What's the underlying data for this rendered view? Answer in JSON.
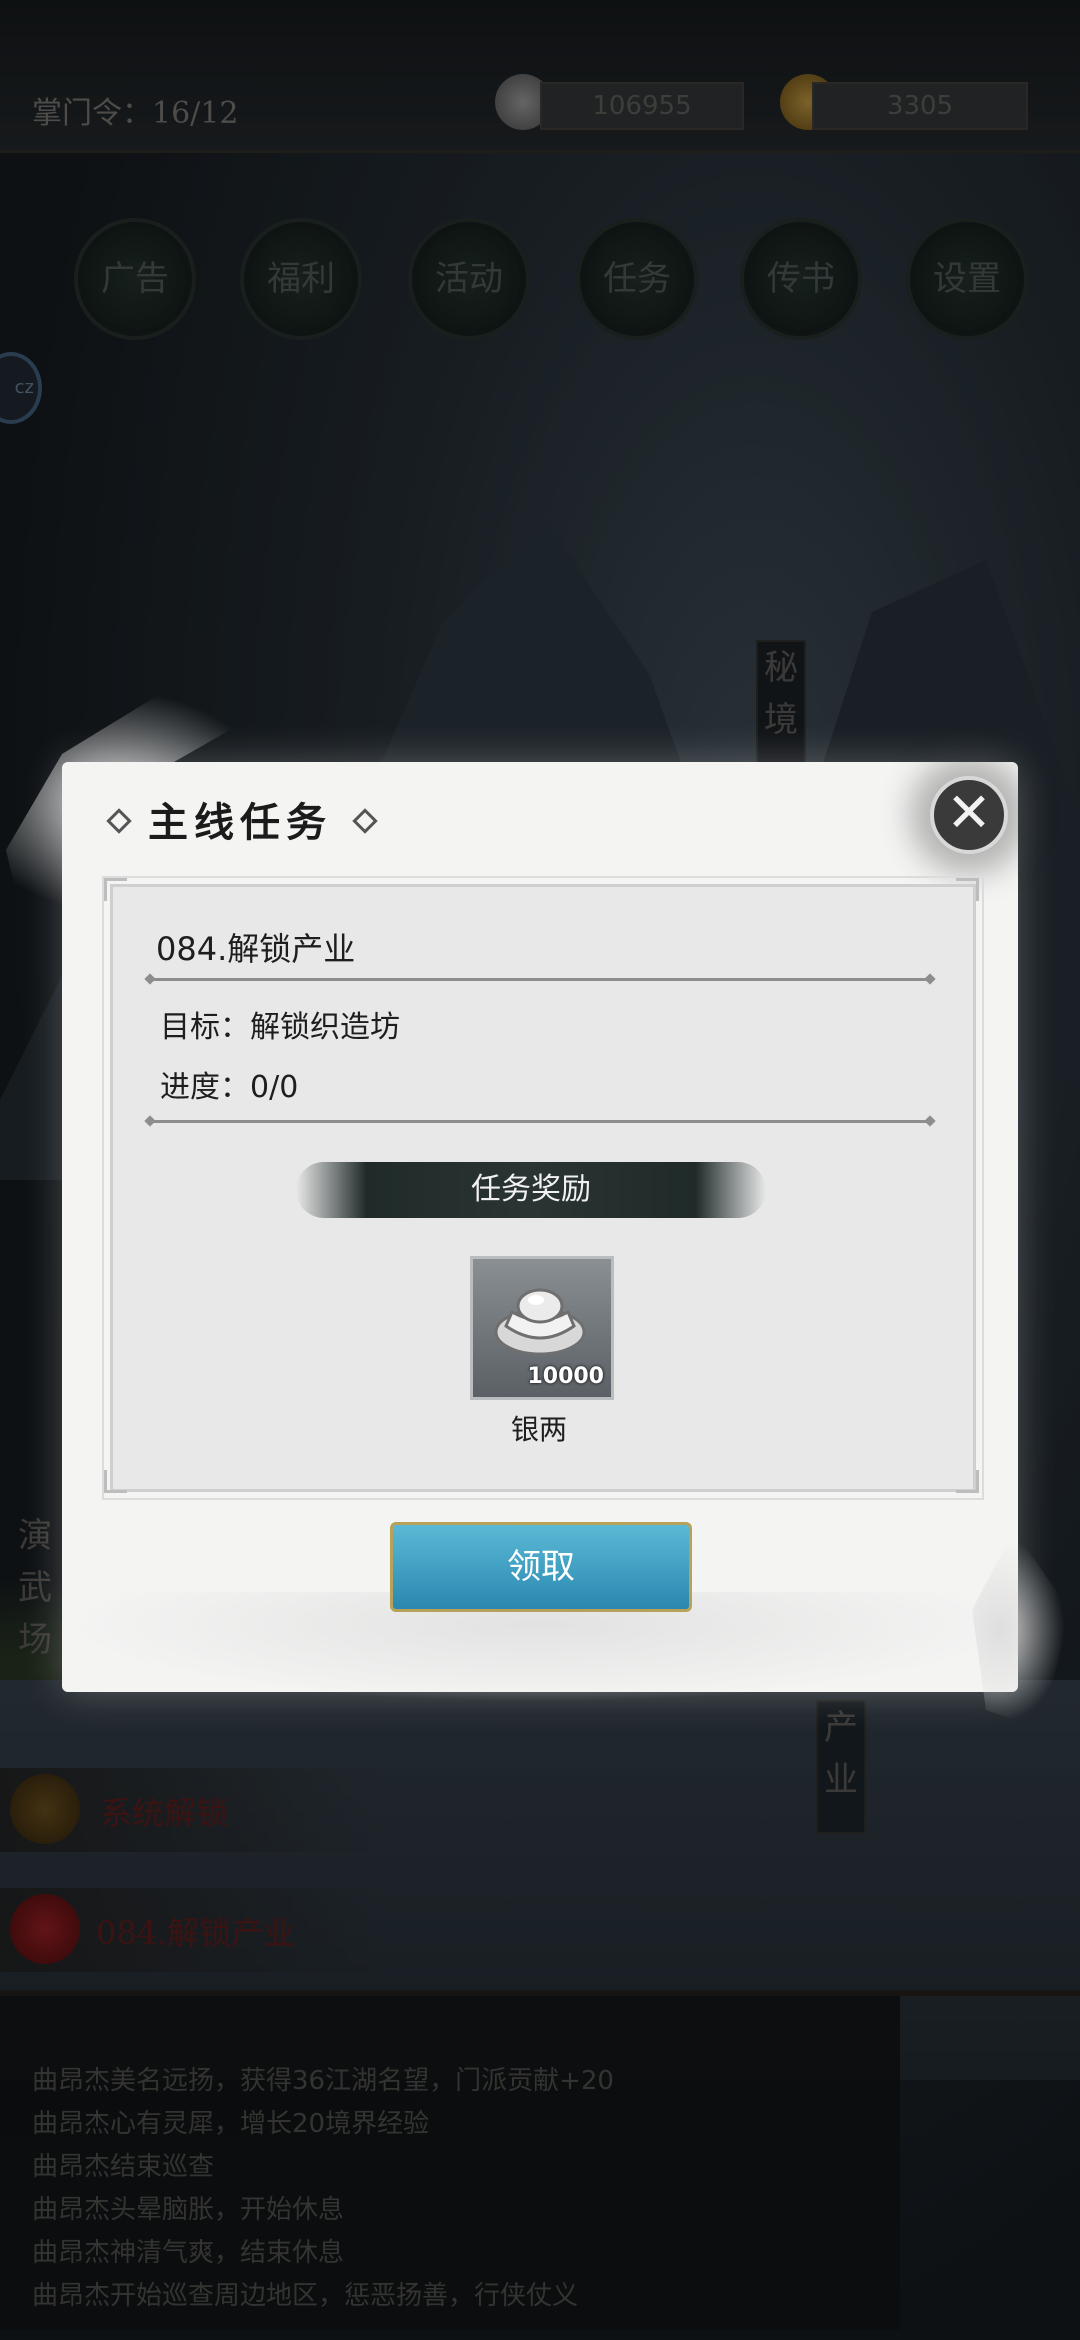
{
  "topbar": {
    "token_label": "掌门令：16/12",
    "silver_amount": "106955",
    "gold_amount": "3305"
  },
  "menu": {
    "items": [
      "广告",
      "福利",
      "活动",
      "任务",
      "传书",
      "设置"
    ]
  },
  "side_badge": "cz",
  "map_tags": {
    "secret_realm": "秘境",
    "arena": "演武场",
    "industry": "产业"
  },
  "notices": {
    "system_unlock": "系统解锁",
    "current_quest": "084.解锁产业"
  },
  "log": {
    "lines": [
      "曲昂杰美名远扬，获得36江湖名望，门派贡献+20",
      "曲昂杰心有灵犀，增长20境界经验",
      "曲昂杰结束巡查",
      "曲昂杰头晕脑胀，开始休息",
      "曲昂杰神清气爽，结束休息",
      "曲昂杰开始巡查周边地区，惩恶扬善，行侠仗义"
    ]
  },
  "dialog": {
    "title": "主线任务",
    "close_icon": "close-icon",
    "quest_name": "084.解锁产业",
    "goal": "目标：解锁织造坊",
    "progress": "进度：0/0",
    "reward_title": "任务奖励",
    "reward_item": {
      "icon": "silver-ingot-icon",
      "count": "10000",
      "name": "银两"
    },
    "claim_label": "领取"
  }
}
